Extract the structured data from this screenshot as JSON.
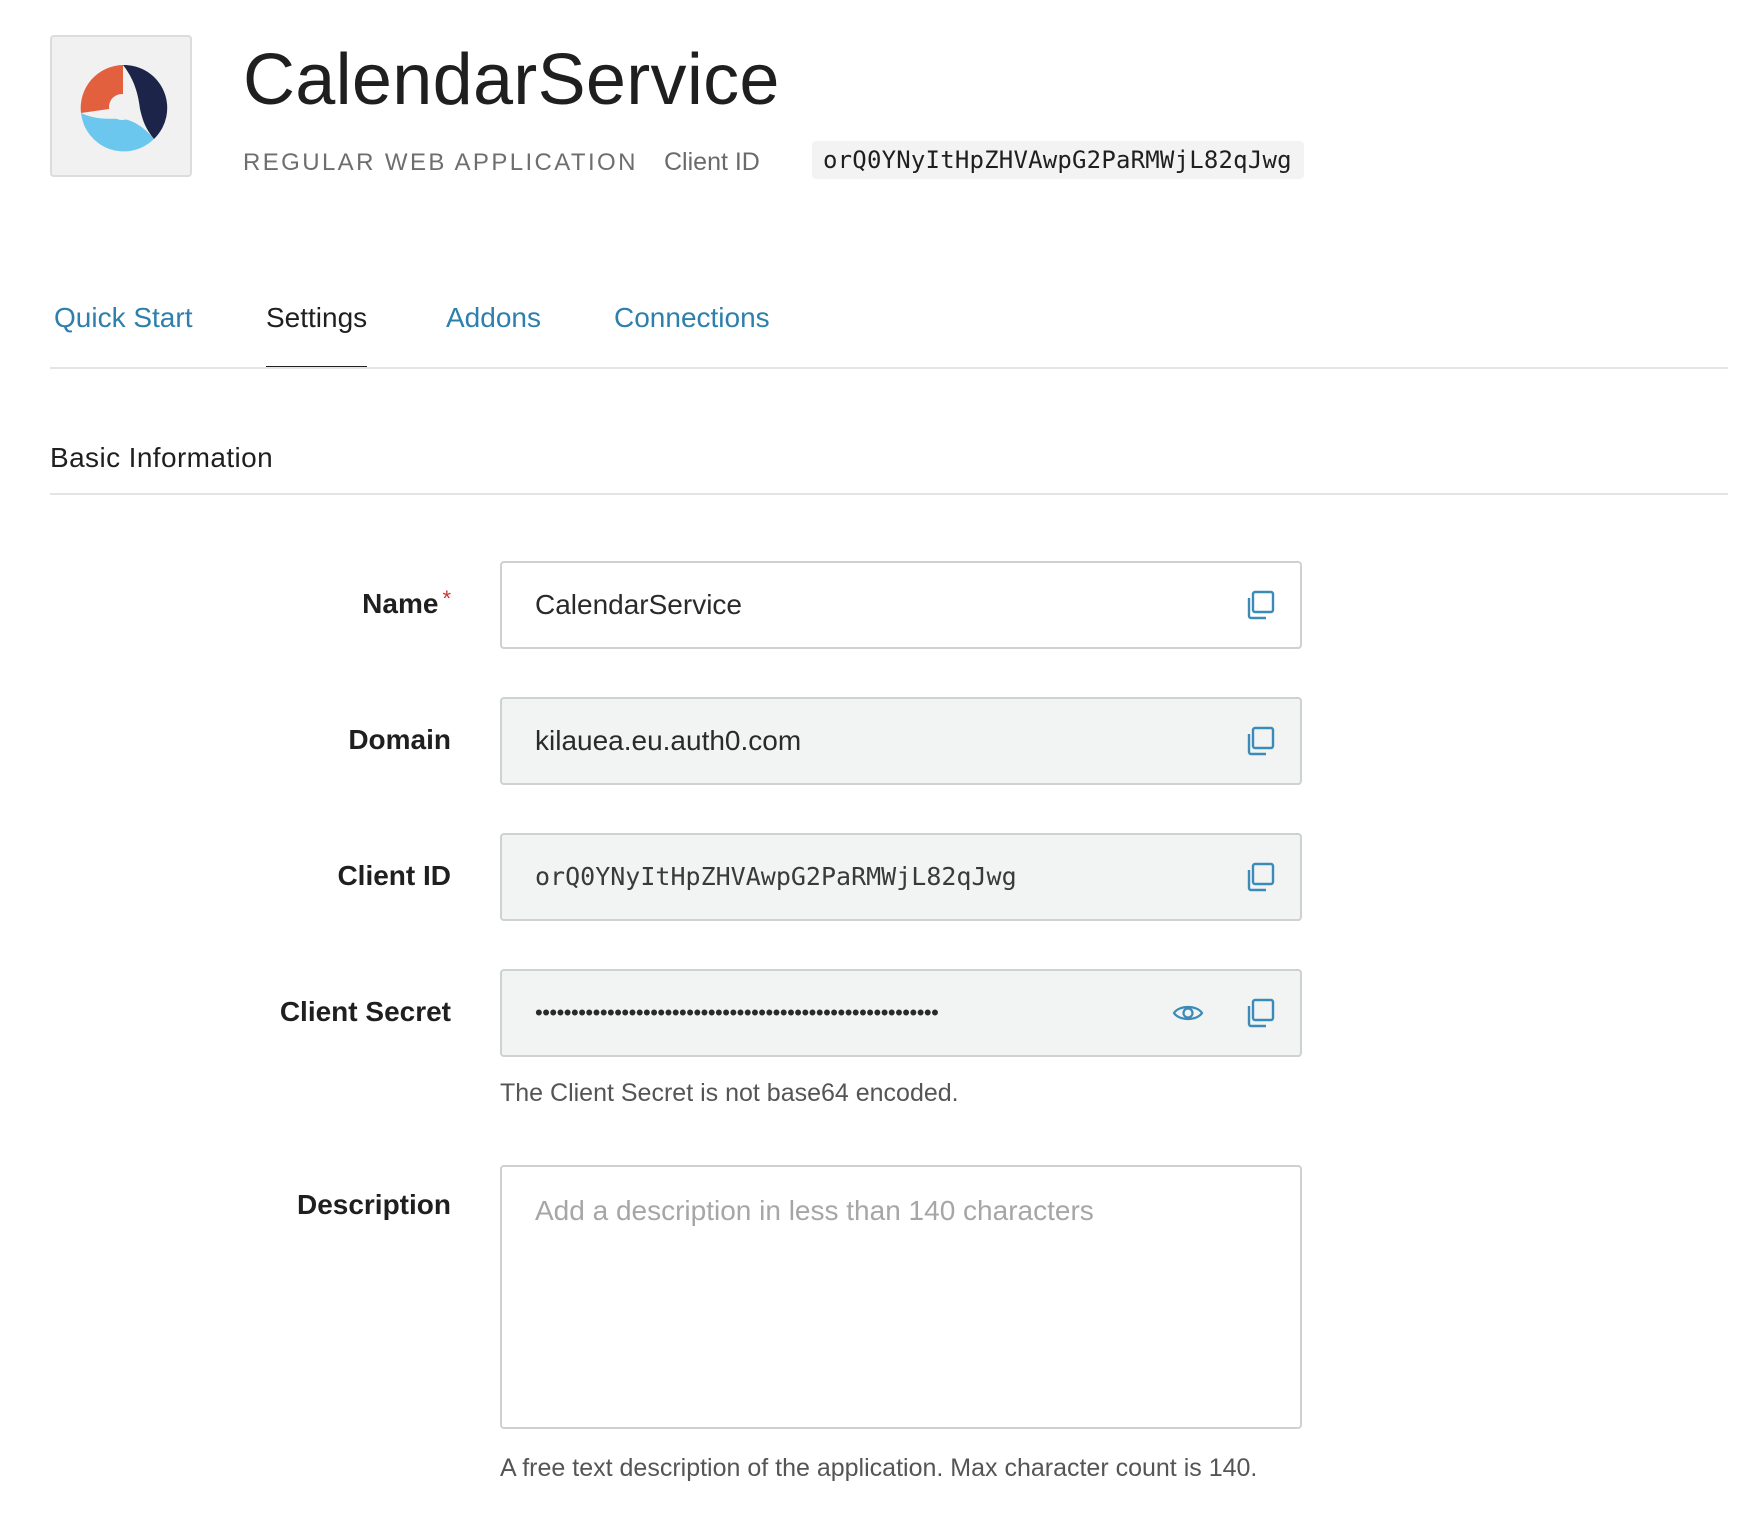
{
  "app": {
    "name": "CalendarService",
    "type_label": "REGULAR WEB APPLICATION",
    "client_id_label": "Client ID",
    "client_id": "orQ0YNyItHpZHVAwpG2PaRMWjL82qJwg",
    "logo_icon": "app-logo-icon",
    "logo_colors": {
      "orange": "#e2603e",
      "navy": "#1c2549",
      "blue": "#6cc7ee"
    }
  },
  "tabs": [
    {
      "label": "Quick Start",
      "active": false
    },
    {
      "label": "Settings",
      "active": true
    },
    {
      "label": "Addons",
      "active": false
    },
    {
      "label": "Connections",
      "active": false
    }
  ],
  "section": {
    "title": "Basic Information"
  },
  "form": {
    "name": {
      "label": "Name",
      "required_mark": "*",
      "value": "CalendarService"
    },
    "domain": {
      "label": "Domain",
      "value": "kilauea.eu.auth0.com"
    },
    "client_id": {
      "label": "Client ID",
      "value": "orQ0YNyItHpZHVAwpG2PaRMWjL82qJwg"
    },
    "client_secret": {
      "label": "Client Secret",
      "masked_value": "••••••••••••••••••••••••••••••••••••••••••••••••••••••••",
      "helper": "The Client Secret is not base64 encoded."
    },
    "description": {
      "label": "Description",
      "value": "",
      "placeholder": "Add a description in less than 140 characters",
      "helper": "A free text description of the application. Max character count is 140."
    }
  },
  "icons": {
    "copy": "copy-icon",
    "reveal": "eye-icon"
  },
  "colors": {
    "link": "#2d7fad",
    "required": "#d0342c",
    "icon": "#3b8ab8"
  }
}
